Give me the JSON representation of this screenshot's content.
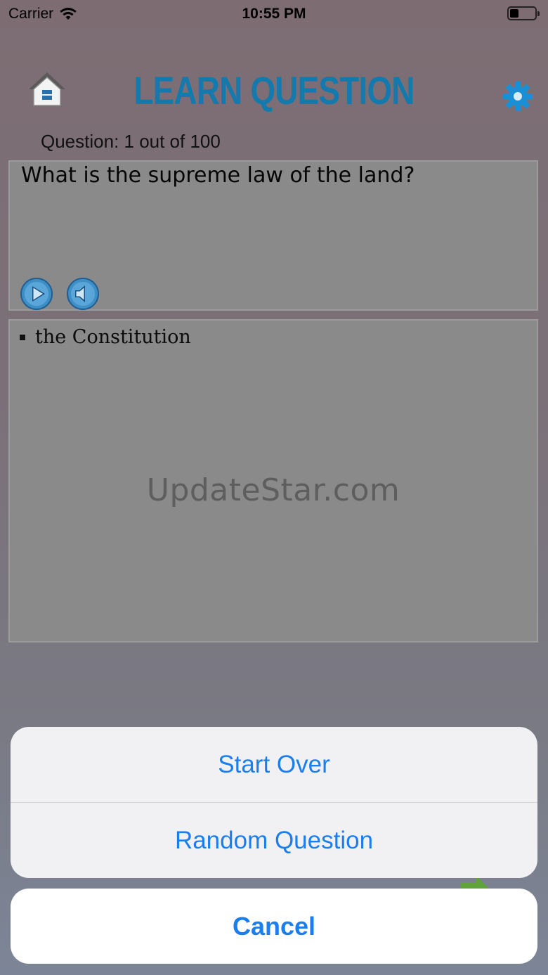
{
  "status_bar": {
    "carrier": "Carrier",
    "time": "10:55 PM",
    "battery_level": 0.35
  },
  "header": {
    "title": "LEARN QUESTION",
    "home_icon": "home-icon",
    "settings_icon": "gear-icon",
    "accent_color": "#1479ad"
  },
  "question": {
    "counter_label": "Question: 1 out of 100",
    "text": "What is the supreme law of the land?",
    "play_icon": "play-icon",
    "speaker_icon": "speaker-icon"
  },
  "answer": {
    "items": [
      "the Constitution"
    ],
    "watermark": "UpdateStar.com"
  },
  "action_sheet": {
    "options": [
      "Start Over",
      "Random Question"
    ],
    "cancel_label": "Cancel",
    "tint_color": "#1b7ef0"
  }
}
